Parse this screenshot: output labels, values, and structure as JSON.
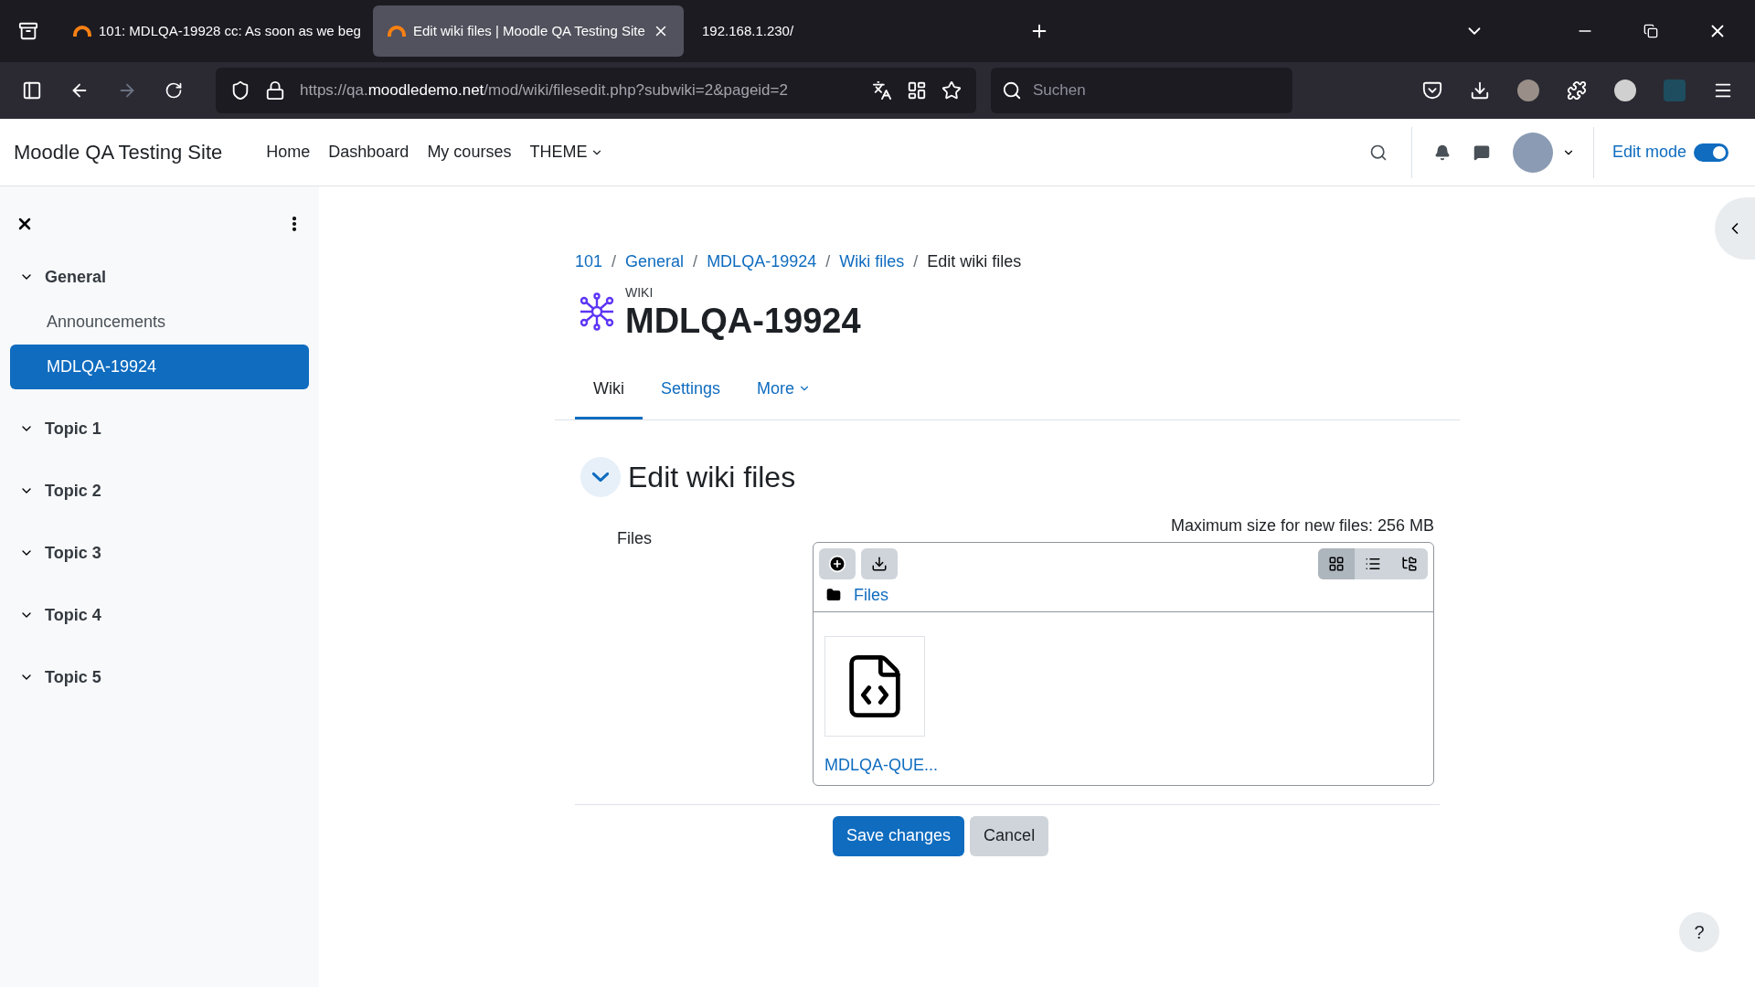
{
  "browser": {
    "tabs": [
      {
        "title": "101: MDLQA-19928 cc: As soon as we beg",
        "selected": false,
        "favicon": true
      },
      {
        "title": "Edit wiki files | Moodle QA Testing Site",
        "selected": true,
        "favicon": true
      },
      {
        "title": "192.168.1.230/",
        "selected": false,
        "favicon": false
      }
    ],
    "url": {
      "prefix": "https://qa.",
      "domain": "moodledemo.net",
      "path": "/mod/wiki/filesedit.php?subwiki=2&pageid=2"
    },
    "search": {
      "placeholder": "Suchen"
    }
  },
  "header": {
    "site_name": "Moodle QA Testing Site",
    "nav": [
      {
        "label": "Home",
        "dropdown": false
      },
      {
        "label": "Dashboard",
        "dropdown": false
      },
      {
        "label": "My courses",
        "dropdown": false
      },
      {
        "label": "THEME",
        "dropdown": true
      }
    ],
    "edit_mode": {
      "label": "Edit mode",
      "on": true
    }
  },
  "sidebar": {
    "sections": [
      {
        "title": "General",
        "expanded": true,
        "children": [
          {
            "label": "Announcements",
            "selected": false
          },
          {
            "label": "MDLQA-19924",
            "selected": true
          }
        ]
      },
      {
        "title": "Topic 1",
        "expanded": true
      },
      {
        "title": "Topic 2",
        "expanded": true
      },
      {
        "title": "Topic 3",
        "expanded": true
      },
      {
        "title": "Topic 4",
        "expanded": true
      },
      {
        "title": "Topic 5",
        "expanded": true
      }
    ]
  },
  "breadcrumb": {
    "separator": "/",
    "items": [
      {
        "label": "101",
        "link": true
      },
      {
        "label": "General",
        "link": true
      },
      {
        "label": "MDLQA-19924",
        "link": true
      },
      {
        "label": "Wiki files",
        "link": true
      },
      {
        "label": "Edit wiki files",
        "link": false
      }
    ]
  },
  "activity": {
    "type": "WIKI",
    "title": "MDLQA-19924"
  },
  "tabs": [
    {
      "label": "Wiki",
      "selected": true,
      "dropdown": false
    },
    {
      "label": "Settings",
      "selected": false,
      "dropdown": false
    },
    {
      "label": "More",
      "selected": false,
      "dropdown": true
    }
  ],
  "section": {
    "title": "Edit wiki files",
    "expanded": true
  },
  "form": {
    "label": "Files",
    "max_size": "Maximum size for new files: 256 MB",
    "folder": "Files",
    "files": [
      {
        "name": "MDLQA-QUE..."
      }
    ],
    "views": [
      {
        "kind": "grid",
        "selected": true
      },
      {
        "kind": "list",
        "selected": false
      },
      {
        "kind": "tree",
        "selected": false
      }
    ]
  },
  "buttons": [
    {
      "label": "Save changes",
      "kind": "primary"
    },
    {
      "label": "Cancel",
      "kind": "secondary"
    }
  ],
  "help": {
    "label": "?"
  }
}
